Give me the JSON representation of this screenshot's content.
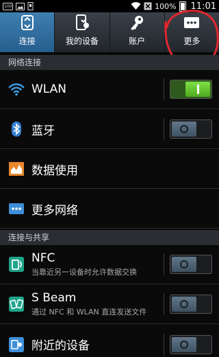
{
  "status_bar": {
    "left_icons": [
      "100",
      "img",
      "usb"
    ],
    "battery": "100%",
    "time": "11:01"
  },
  "tabs": [
    {
      "label": "连接",
      "icon": "connections-icon",
      "active": true
    },
    {
      "label": "我的设备",
      "icon": "my-device-icon",
      "active": false
    },
    {
      "label": "账户",
      "icon": "accounts-icon",
      "active": false
    },
    {
      "label": "更多",
      "icon": "more-icon",
      "active": false
    }
  ],
  "sections": {
    "network": "网络连接",
    "share": "连接与共享"
  },
  "rows": {
    "wlan": {
      "title": "WLAN",
      "toggle": "on"
    },
    "bluetooth": {
      "title": "蓝牙",
      "toggle": "off"
    },
    "data_usage": {
      "title": "数据使用"
    },
    "more_networks": {
      "title": "更多网络"
    },
    "nfc": {
      "title": "NFC",
      "subtitle": "当靠近另一设备时允许数据交换",
      "toggle": "off"
    },
    "sbeam": {
      "title": "S Beam",
      "subtitle": "通过 NFC 和 WLAN 直连发送文件",
      "toggle": "off"
    },
    "nearby": {
      "title": "附近的设备",
      "toggle": "off"
    }
  },
  "colors": {
    "accent_tab": "#2f6fa0",
    "toggle_on": "#5ec02a",
    "annotation": "#e0282e"
  }
}
